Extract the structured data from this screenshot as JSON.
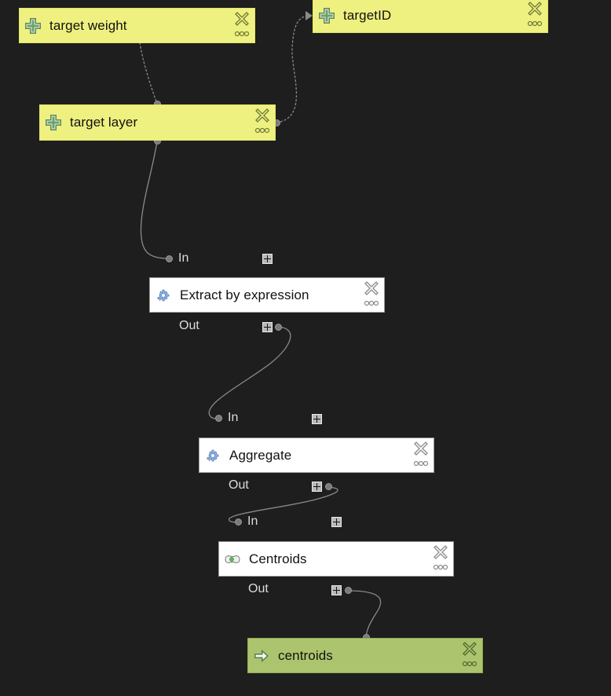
{
  "colors": {
    "canvas_bg": "#1e1e1e",
    "input_node": "#eef07f",
    "algorithm_node": "#ffffff",
    "output_node": "#adc46e",
    "wire": "#8a8a8a"
  },
  "inputs": [
    {
      "id": "target-weight",
      "label": "target weight",
      "icon": "plus-cross-icon"
    },
    {
      "id": "targetID",
      "label": "targetID",
      "icon": "plus-cross-icon"
    },
    {
      "id": "target-layer",
      "label": "target layer",
      "icon": "plus-cross-icon"
    }
  ],
  "algorithms": [
    {
      "id": "extract-by-expression",
      "label": "Extract by expression",
      "icon": "gear-icon",
      "in_label": "In",
      "out_label": "Out"
    },
    {
      "id": "aggregate",
      "label": "Aggregate",
      "icon": "gear-icon",
      "in_label": "In",
      "out_label": "Out"
    },
    {
      "id": "centroids",
      "label": "Centroids",
      "icon": "centroid-icon",
      "in_label": "In",
      "out_label": "Out"
    }
  ],
  "outputs": [
    {
      "id": "centroids-output",
      "label": "centroids",
      "icon": "arrow-right-icon"
    }
  ],
  "connections": [
    {
      "from": "target weight",
      "to": "target layer",
      "style": "dashed",
      "kind": "dependency"
    },
    {
      "from": "target layer",
      "to": "targetID",
      "style": "dashed",
      "kind": "dependency"
    },
    {
      "from": "target layer",
      "to": "Extract by expression.In",
      "style": "solid"
    },
    {
      "from": "Extract by expression.Out",
      "to": "Aggregate.In",
      "style": "solid"
    },
    {
      "from": "Aggregate.Out",
      "to": "Centroids.In",
      "style": "solid"
    },
    {
      "from": "Centroids.Out",
      "to": "centroids",
      "style": "solid"
    }
  ]
}
